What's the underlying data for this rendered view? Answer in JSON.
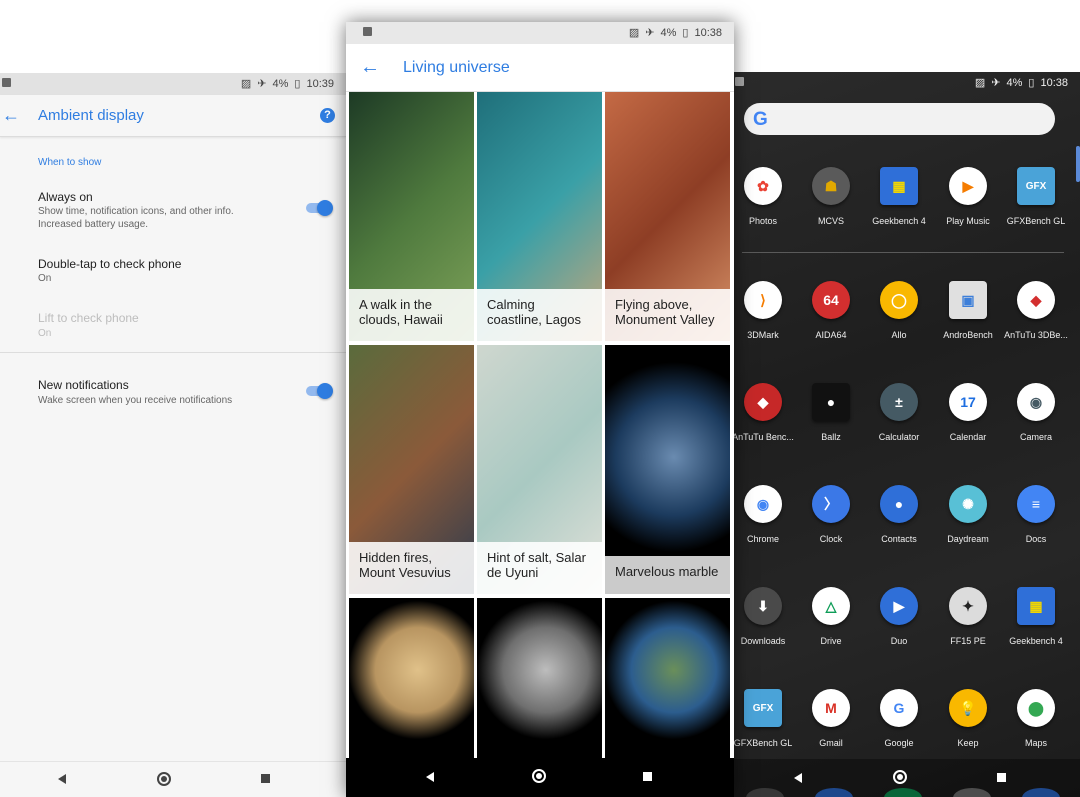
{
  "left": {
    "status": {
      "battery": "4%",
      "time": "10:39"
    },
    "title": "Ambient display",
    "section": "When to show",
    "prefs": [
      {
        "title": "Always on",
        "subtitle": "Show time, notification icons, and other info. Increased battery usage.",
        "enabled": true,
        "toggle": true
      },
      {
        "title": "Double-tap to check phone",
        "subtitle": "On",
        "enabled": true,
        "toggle": false
      },
      {
        "title": "Lift to check phone",
        "subtitle": "On",
        "enabled": false,
        "toggle": false
      },
      {
        "title": "New notifications",
        "subtitle": "Wake screen when you receive notifications",
        "enabled": true,
        "toggle": true
      }
    ],
    "accent": "#2f7de1"
  },
  "middle": {
    "status": {
      "battery": "4%",
      "time": "10:38"
    },
    "title": "Living universe",
    "tiles": [
      {
        "caption": "A walk in the clouds, Hawaii",
        "colors": [
          "#1d3a25",
          "#4f7a3e",
          "#7fa35a"
        ]
      },
      {
        "caption": "Calming coastline, Lagos",
        "colors": [
          "#1f6f7a",
          "#3aa0a7",
          "#c9a67a"
        ]
      },
      {
        "caption": "Flying above, Monument Valley",
        "colors": [
          "#c46a45",
          "#8e3e25",
          "#d9946a"
        ]
      },
      {
        "caption": "Hidden fires, Mount Vesuvius",
        "colors": [
          "#5a6b3c",
          "#8b5a3a",
          "#2b3a4e"
        ]
      },
      {
        "caption": "Hint of salt, Salar de Uyuni",
        "colors": [
          "#cfd7cf",
          "#a9c9c2",
          "#e3e2da"
        ]
      },
      {
        "caption": "Marvelous marble",
        "colors": [
          "#000000",
          "#1c3b5e",
          "#6a8bb0"
        ]
      },
      {
        "caption": "",
        "colors": [
          "#000000",
          "#b89561",
          "#e0c189"
        ]
      },
      {
        "caption": "",
        "colors": [
          "#000000",
          "#6f6f6f",
          "#bdbdbd"
        ]
      },
      {
        "caption": "",
        "colors": [
          "#000000",
          "#2c5d8e",
          "#6a8f5a"
        ]
      }
    ]
  },
  "right": {
    "status": {
      "battery": "4%",
      "time": "10:38"
    },
    "search_logo": "G",
    "apps": [
      {
        "label": "Photos",
        "icon": "photos-icon",
        "glyph": "✿",
        "bg": "#ffffff",
        "fg": "#ea4335"
      },
      {
        "label": "MCVS",
        "icon": "mcvs-icon",
        "glyph": "☗",
        "bg": "#5a5a5a",
        "fg": "#e0a800"
      },
      {
        "label": "Geekbench 4",
        "icon": "geekbench-icon",
        "glyph": "▦",
        "bg": "#2f6fd8",
        "fg": "#f2d600",
        "square": true
      },
      {
        "label": "Play Music",
        "icon": "play-music-icon",
        "glyph": "▶",
        "bg": "#ffffff",
        "fg": "#f57c00"
      },
      {
        "label": "GFXBench GL",
        "icon": "gfxbench-icon",
        "glyph": "GFX",
        "bg": "#4aa3d8",
        "fg": "#ffffff",
        "square": true
      },
      {
        "label": "3DMark",
        "icon": "3dmark-icon",
        "glyph": "⟩",
        "bg": "#ffffff",
        "fg": "#f57c00"
      },
      {
        "label": "AIDA64",
        "icon": "aida64-icon",
        "glyph": "64",
        "bg": "#d32f2f",
        "fg": "#ffffff"
      },
      {
        "label": "Allo",
        "icon": "allo-icon",
        "glyph": "◯",
        "bg": "#f9b800",
        "fg": "#ffffff"
      },
      {
        "label": "AndroBench",
        "icon": "androbench-icon",
        "glyph": "▣",
        "bg": "#e0e0e0",
        "fg": "#3d7fd9",
        "square": true
      },
      {
        "label": "AnTuTu 3DBe...",
        "icon": "antutu-3d-icon",
        "glyph": "◆",
        "bg": "#ffffff",
        "fg": "#d32f2f"
      },
      {
        "label": "AnTuTu Benc...",
        "icon": "antutu-icon",
        "glyph": "◆",
        "bg": "#c62828",
        "fg": "#ffffff"
      },
      {
        "label": "Ballz",
        "icon": "ballz-icon",
        "glyph": "●",
        "bg": "#111111",
        "fg": "#ffffff",
        "square": true
      },
      {
        "label": "Calculator",
        "icon": "calculator-icon",
        "glyph": "±",
        "bg": "#455a64",
        "fg": "#ffffff"
      },
      {
        "label": "Calendar",
        "icon": "calendar-icon",
        "glyph": "17",
        "bg": "#ffffff",
        "fg": "#1e6ee0"
      },
      {
        "label": "Camera",
        "icon": "camera-icon",
        "glyph": "◉",
        "bg": "#ffffff",
        "fg": "#455a64"
      },
      {
        "label": "Chrome",
        "icon": "chrome-icon",
        "glyph": "◉",
        "bg": "#ffffff",
        "fg": "#4285f4"
      },
      {
        "label": "Clock",
        "icon": "clock-icon",
        "glyph": "〉",
        "bg": "#3b78e7",
        "fg": "#ffffff"
      },
      {
        "label": "Contacts",
        "icon": "contacts-icon",
        "glyph": "●",
        "bg": "#2f6fd8",
        "fg": "#ffffff"
      },
      {
        "label": "Daydream",
        "icon": "daydream-icon",
        "glyph": "✺",
        "bg": "#58c0d6",
        "fg": "#ffffff"
      },
      {
        "label": "Docs",
        "icon": "docs-icon",
        "glyph": "≡",
        "bg": "#4285f4",
        "fg": "#ffffff"
      },
      {
        "label": "Downloads",
        "icon": "downloads-icon",
        "glyph": "⬇",
        "bg": "#4a4a4a",
        "fg": "#ffffff"
      },
      {
        "label": "Drive",
        "icon": "drive-icon",
        "glyph": "△",
        "bg": "#ffffff",
        "fg": "#0f9d58"
      },
      {
        "label": "Duo",
        "icon": "duo-icon",
        "glyph": "▶",
        "bg": "#2f6fd8",
        "fg": "#ffffff"
      },
      {
        "label": "FF15 PE",
        "icon": "ff15-icon",
        "glyph": "✦",
        "bg": "#dcdcdc",
        "fg": "#222222"
      },
      {
        "label": "Geekbench 4",
        "icon": "geekbench-icon",
        "glyph": "▦",
        "bg": "#2f6fd8",
        "fg": "#f2d600",
        "square": true
      },
      {
        "label": "GFXBench GL",
        "icon": "gfxbench-icon",
        "glyph": "GFX",
        "bg": "#4aa3d8",
        "fg": "#ffffff",
        "square": true
      },
      {
        "label": "Gmail",
        "icon": "gmail-icon",
        "glyph": "M",
        "bg": "#ffffff",
        "fg": "#d93025"
      },
      {
        "label": "Google",
        "icon": "google-icon",
        "glyph": "G",
        "bg": "#ffffff",
        "fg": "#4285f4"
      },
      {
        "label": "Keep",
        "icon": "keep-icon",
        "glyph": "💡",
        "bg": "#f9b800",
        "fg": "#ffffff"
      },
      {
        "label": "Maps",
        "icon": "maps-icon",
        "glyph": "⬤",
        "bg": "#ffffff",
        "fg": "#34a853"
      }
    ]
  }
}
